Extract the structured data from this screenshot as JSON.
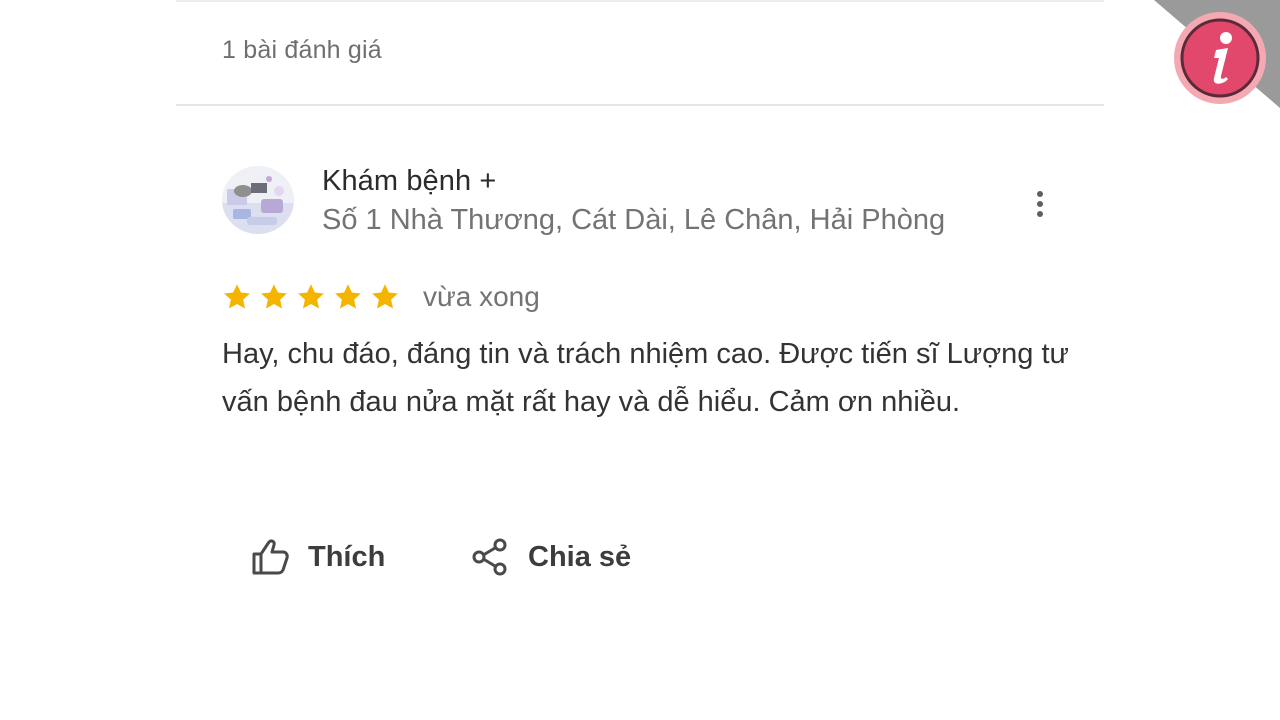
{
  "reviews_summary": {
    "count_label": "1 bài đánh giá"
  },
  "review": {
    "reviewer_name": "Khám bệnh +",
    "reviewer_address": "Số 1 Nhà Thương, Cát Dài, Lê Chân, Hải Phòng",
    "rating": 5,
    "rating_max": 5,
    "time_label": "vừa xong",
    "text": "Hay, chu đáo, đáng tin và trách nhiệm cao. Được tiến sĩ Lượng tư vấn bệnh đau nửa mặt rất hay và dễ hiểu. Cảm ơn nhiều."
  },
  "actions": {
    "like_label": "Thích",
    "share_label": "Chia sẻ"
  },
  "icons": {
    "more": "more-vertical-icon",
    "like": "thumbs-up-icon",
    "share": "share-icon",
    "star": "star-icon",
    "badge": "info-icon"
  },
  "colors": {
    "star": "#f4b400",
    "badge_ring": "#f4a9b2",
    "badge_fill": "#e2486b",
    "corner": "#9a9a9a"
  }
}
